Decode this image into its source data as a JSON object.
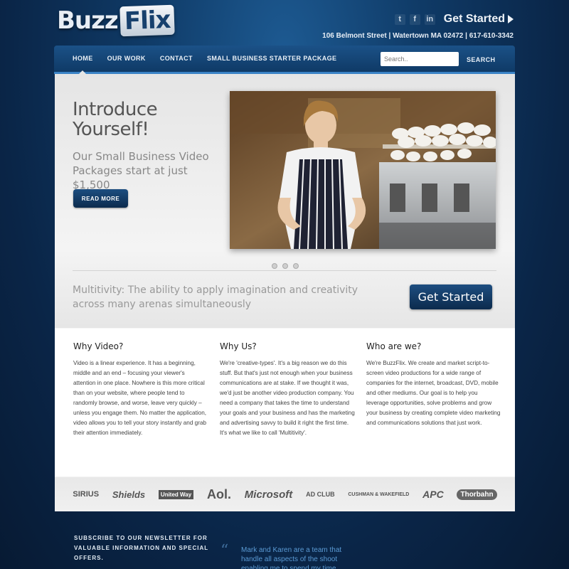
{
  "header": {
    "logo_left": "Buzz",
    "logo_right": "Flix",
    "social_icons": [
      "twitter-icon",
      "facebook-icon",
      "linkedin-icon"
    ],
    "get_started": "Get Started",
    "address": "106 Belmont Street | Watertown MA 02472 | 617-610-3342"
  },
  "nav": {
    "items": [
      "HOME",
      "OUR WORK",
      "CONTACT",
      "SMALL BUSINESS STARTER PACKAGE"
    ],
    "search_placeholder": "Search..",
    "search_label": "SEARCH"
  },
  "hero": {
    "title": "Introduce Yourself!",
    "subtitle": "Our Small Business Video Packages start at just $1,500",
    "button": "READ MORE"
  },
  "tagline": {
    "text": "Multitivity: The ability to apply imagination and creativity across many arenas simultaneously",
    "button": "Get Started"
  },
  "columns": [
    {
      "title": "Why Video?",
      "text": "Video is a linear experience. It has a beginning, middle and an end – focusing your viewer's attention in one place. Nowhere is this more critical than on your website, where people tend to randomly browse, and worse, leave very quickly – unless you engage them. No matter the application, video allows you to tell your story instantly and grab their attention immediately."
    },
    {
      "title": "Why Us?",
      "text": "We're 'creative-types'. It's a big reason we do this stuff. But that's just not enough when your business communications are at stake. If we thought it was, we'd just be another video production company. You need a company that takes the time to understand your goals and your business and has the marketing and advertising savvy to build it right the first time.",
      "text2": "It's what we like to call 'Multitivity'."
    },
    {
      "title": "Who are we?",
      "text": "We're BuzzFlix. We create and market script-to-screen video productions for a wide range of companies for the internet, broadcast, DVD, mobile and other mediums. Our goal is to help you leverage opportunities, solve problems and grow your business by creating complete video marketing and communications solutions that just work."
    }
  ],
  "client_logos": [
    "SIRIUS",
    "Shields",
    "United Way",
    "Aol.",
    "Microsoft",
    "AD CLUB",
    "CUSHMAN & WAKEFIELD",
    "APC",
    "Thorbahn"
  ],
  "footer": {
    "newsletter": "SUBSCRIBE TO OUR NEWSLETTER FOR VALUABLE INFORMATION AND SPECIAL OFFERS.",
    "testimonial": "Mark and Karen are a team that handle all aspects of the shoot enabling me to spend my time"
  }
}
